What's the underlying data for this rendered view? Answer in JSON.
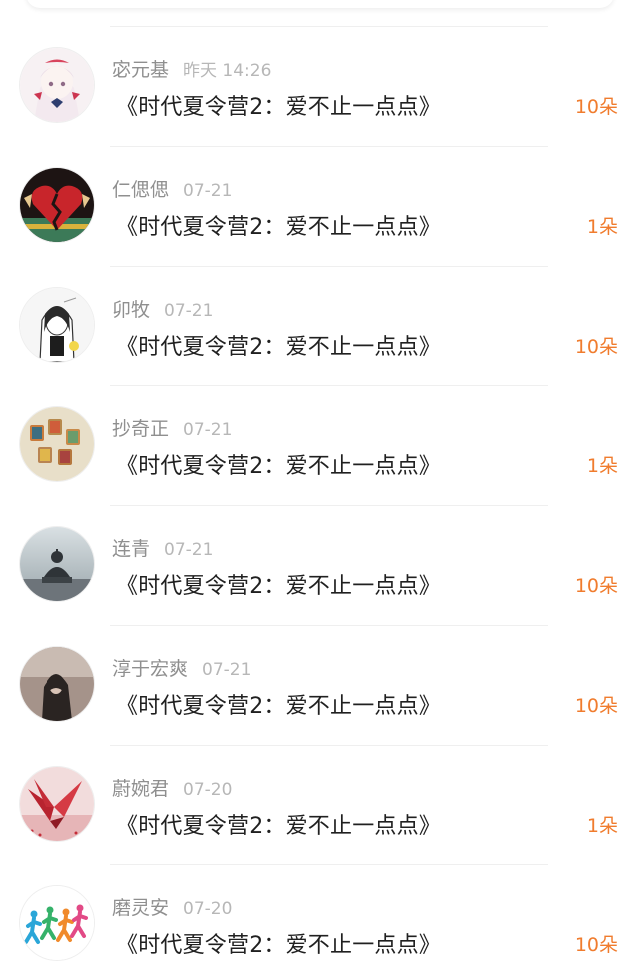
{
  "accent_color": "#f07c2e",
  "gifts": [
    {
      "user": "宓元基",
      "time": "昨天 14:26",
      "title": "《时代夏令营2：爱不止一点点》",
      "count": "10朵",
      "avatar": "anime-girl-avatar"
    },
    {
      "user": "仁偲偲",
      "time": "07-21",
      "title": "《时代夏令营2：爱不止一点点》",
      "count": "1朵",
      "avatar": "broken-heart-avatar"
    },
    {
      "user": "卯牧",
      "time": "07-21",
      "title": "《时代夏令营2：爱不止一点点》",
      "count": "10朵",
      "avatar": "sketch-girl-avatar"
    },
    {
      "user": "抄奇正",
      "time": "07-21",
      "title": "《时代夏令营2：爱不止一点点》",
      "count": "1朵",
      "avatar": "thread-spools-avatar"
    },
    {
      "user": "连青",
      "time": "07-21",
      "title": "《时代夏令营2：爱不止一点点》",
      "count": "10朵",
      "avatar": "buddha-statue-avatar"
    },
    {
      "user": "淳于宏爽",
      "time": "07-21",
      "title": "《时代夏令营2：爱不止一点点》",
      "count": "10朵",
      "avatar": "dark-portrait-avatar"
    },
    {
      "user": "蔚婉君",
      "time": "07-20",
      "title": "《时代夏令营2：爱不止一点点》",
      "count": "1朵",
      "avatar": "paper-crane-avatar"
    },
    {
      "user": "磨灵安",
      "time": "07-20",
      "title": "《时代夏令营2：爱不止一点点》",
      "count": "10朵",
      "avatar": "runners-avatar"
    }
  ]
}
